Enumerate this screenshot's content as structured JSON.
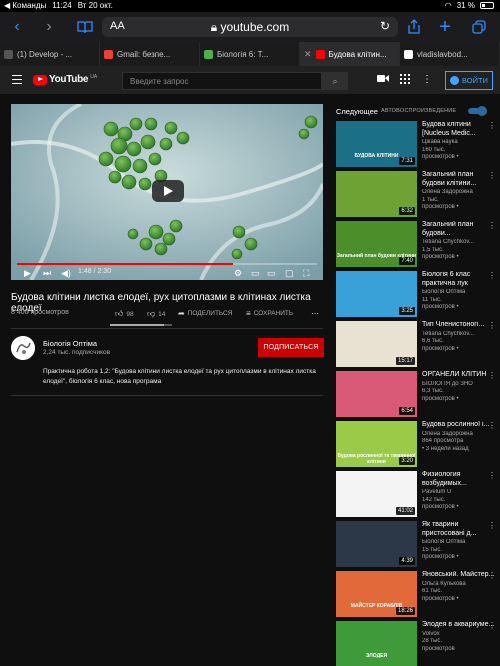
{
  "status": {
    "carrier": "◀ Команды",
    "time": "11:24",
    "date": "Вт 20 окт.",
    "battery": "31 %"
  },
  "browser": {
    "text_size_label": "AA",
    "url": "youtube.com",
    "tabs": [
      {
        "title": "(1) Develop - ...",
        "favicon_color": "#555555",
        "active": false
      },
      {
        "title": "Gmail: безпе...",
        "favicon_color": "#ea4335",
        "active": false
      },
      {
        "title": "Біологія 6: Т...",
        "favicon_color": "#4caf50",
        "active": false
      },
      {
        "title": "Будова клітин...",
        "favicon_color": "#ff0000",
        "active": true
      },
      {
        "title": "vladislavbod...",
        "favicon_color": "#ffffff",
        "active": false
      }
    ]
  },
  "youtube": {
    "logo_text": "YouTube",
    "country": "UA",
    "search_placeholder": "Введите запрос",
    "login_label": "ВОЙТИ"
  },
  "video": {
    "current_time": "1:48",
    "duration": "2:30",
    "progress": 0.72,
    "title": "Будова клітини листка елодеї, рух цитоплазми в клітинах листка елодеї",
    "views": "8 400 просмотров",
    "likes": "98",
    "dislikes": "14",
    "like_ratio": 0.875,
    "share_label": "ПОДЕЛИТЬСЯ",
    "save_label": "СОХРАНИТЬ",
    "channel": "Біологія Оптіма",
    "subscribers": "2,24 тыс. подписчиков",
    "subscribe_label": "ПОДПИСАТЬСЯ",
    "description": "Практична робота 1,2: \"Будова клітини листка елодеї та рух цитоплазми в клітинах листка елодеї\", біологія 6 клас, нова програма"
  },
  "sidebar": {
    "next_label": "Следующее",
    "autoplay_label": "АВТОВОСПРОИЗВЕДЕНИЕ",
    "items": [
      {
        "title": "Будова клітини [Nucleus Medic...",
        "channel": "Цікава наука",
        "views": "160 тыс.",
        "age": "просмотров •",
        "duration": "7:31",
        "bg": "#1b6f86",
        "caption": "БУДОВА КЛІТИНИ"
      },
      {
        "title": "Загальний план будови клітини...",
        "channel": "Олена Задорожна",
        "views": "1 тыс.",
        "age": "просмотров •",
        "duration": "6:32",
        "bg": "#6fa234",
        "caption": ""
      },
      {
        "title": "Загальний план будови...",
        "channel": "Tetiana Chychkov...",
        "views": "1,5 тыс.",
        "age": "просмотров •",
        "duration": "7:40",
        "bg": "#4c8f2a",
        "caption": "Загальний план будови клітини"
      },
      {
        "title": "Біологія 6 клас практична лук",
        "channel": "Біологія Оптіма",
        "views": "11 тыс.",
        "age": "просмотров •",
        "duration": "3:25",
        "bg": "#3aa0d8",
        "caption": ""
      },
      {
        "title": "Тип Членистоногі...",
        "channel": "Tetiana Chychkov...",
        "views": "6,6 тыс.",
        "age": "просмотров •",
        "duration": "15:17",
        "bg": "#e8e2d2",
        "caption": ""
      },
      {
        "title": "ОРГАНЕЛИ КЛІТИН",
        "channel": "БІОЛОГІЯ до ЗНО",
        "views": "6,3 тыс.",
        "age": "просмотров •",
        "duration": "6:54",
        "bg": "#d85a76",
        "caption": ""
      },
      {
        "title": "Будова рослинної і...",
        "channel": "Олена Задорожна",
        "views": "864 просмотра",
        "age": "• 3 недели назад",
        "duration": "3:20",
        "bg": "#9acb48",
        "caption": "Будова рослинної та тваринної клітини"
      },
      {
        "title": "Физиология возбудимых...",
        "channel": "Pavelum U",
        "views": "142 тыс.",
        "age": "просмотров •",
        "duration": "41:02",
        "bg": "#f4f4f4",
        "caption": ""
      },
      {
        "title": "Як тварини пристосовані д...",
        "channel": "Біологія Оптіма",
        "views": "15 тыс.",
        "age": "просмотров •",
        "duration": "4:39",
        "bg": "#2c3848",
        "caption": ""
      },
      {
        "title": "Яновський. Майстер...",
        "channel": "Ольга Кулькова",
        "views": "61 тыс.",
        "age": "просмотров •",
        "duration": "18:26",
        "bg": "#e26a3a",
        "caption": "МАЙСТЕР КОРАБЛІВ"
      },
      {
        "title": "Элодея в аквариуме...",
        "channel": "Volvox",
        "views": "28 тыс.",
        "age": "просмотров",
        "duration": "",
        "bg": "#3f9a3a",
        "caption": "ЭЛОДЕЯ"
      }
    ]
  }
}
